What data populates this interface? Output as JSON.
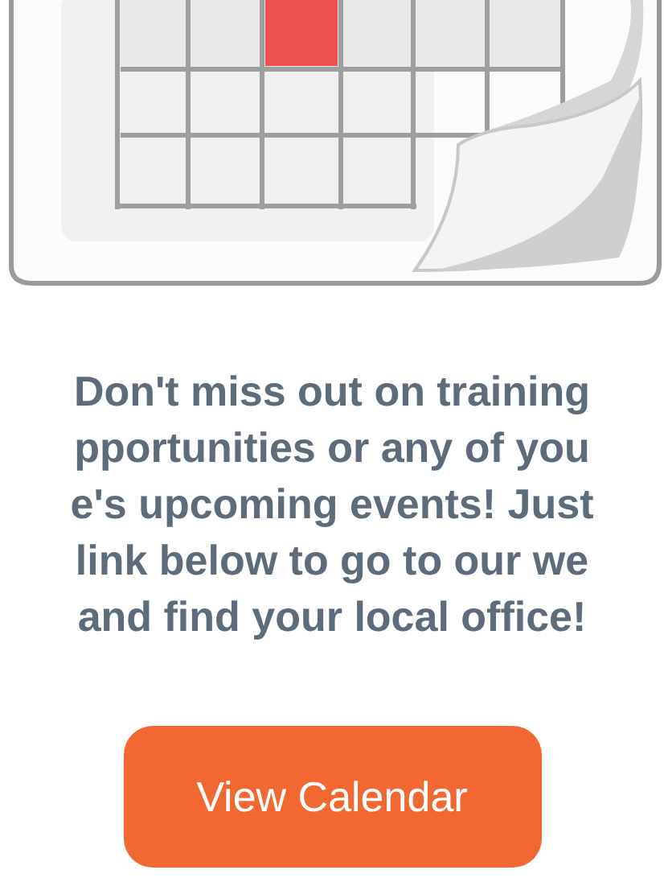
{
  "message": {
    "lines": [
      "Don't miss out on training",
      "pportunities or any of you",
      "e's upcoming events! Just",
      "link below to go to our we",
      "and find your local office!"
    ]
  },
  "button": {
    "label": "View Calendar"
  }
}
